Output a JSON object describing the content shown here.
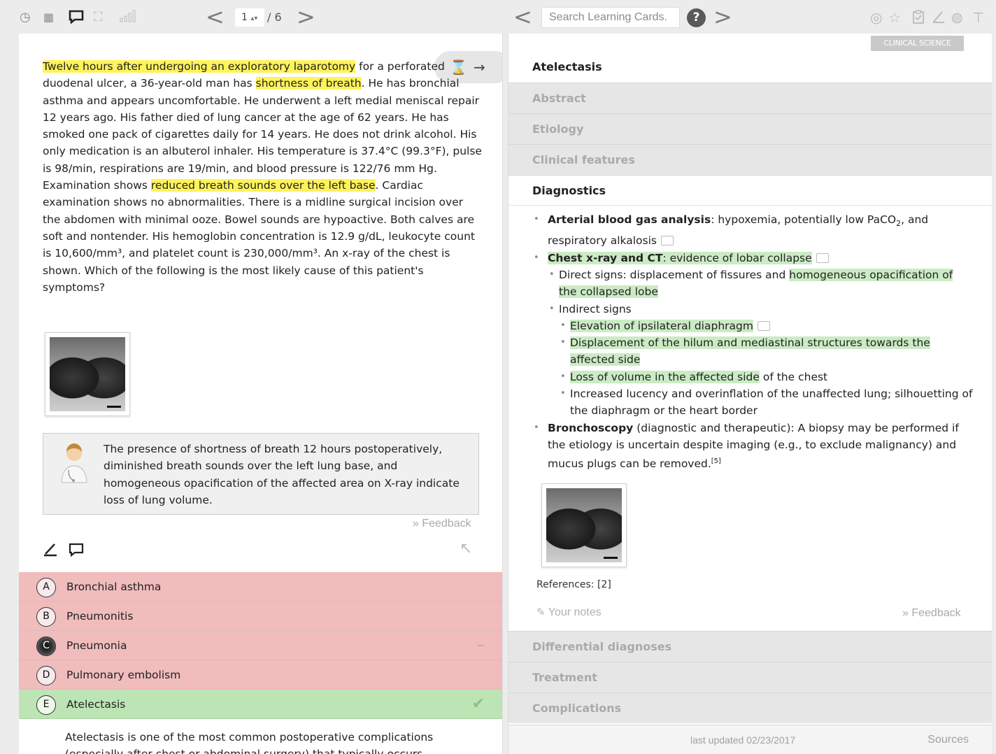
{
  "toolbar": {
    "page_current": "1",
    "page_total": "/ 6",
    "search_placeholder": "Search Learning Cards.",
    "help_label": "?"
  },
  "question": {
    "parts": [
      {
        "t": "Twelve hours after undergoing an exploratory laparotomy",
        "hl": true
      },
      {
        "t": " for a perforated duodenal ulcer, a 36-year-old man has ",
        "hl": false
      },
      {
        "t": "shortness of breath",
        "hl": true
      },
      {
        "t": ". He has bronchial asthma and appears uncomfortable. He underwent a left medial meniscal repair 12 years ago. His father died of lung cancer at the age of 62 years. He has smoked one pack of cigarettes daily for 14 years. He does not drink alcohol. His only medication is an albuterol inhaler. His temperature is 37.4°C (99.3°F), pulse is 98/min, respirations are 19/min, and blood pressure is 122/76 mm Hg. Examination shows ",
        "hl": false
      },
      {
        "t": "reduced breath sounds over the left base",
        "hl": true
      },
      {
        "t": ". Cardiac examination shows no abnormalities. There is a midline surgical incision over the abdomen with minimal ooze. Bowel sounds are hypoactive. Both calves are soft and nontender. His hemoglobin concentration is 12.9 g/dL, leukocyte count is 10,600/mm³, and platelet count is 230,000/mm³. An x-ray of the chest is shown. Which of the following is the most likely cause of this patient's symptoms?",
        "hl": false
      }
    ]
  },
  "explanation": "The presence of shortness of breath 12 hours postoperatively, diminished breath sounds over the left lung base, and homogeneous opacification of the affected area on X-ray indicate loss of lung volume.",
  "feedback_label": "» Feedback",
  "answers": [
    {
      "letter": "A",
      "label": "Bronchial asthma",
      "state": "wrong",
      "mark": ""
    },
    {
      "letter": "B",
      "label": "Pneumonitis",
      "state": "wrong",
      "mark": ""
    },
    {
      "letter": "C",
      "label": "Pneumonia",
      "state": "chosen",
      "mark": "–"
    },
    {
      "letter": "D",
      "label": "Pulmonary embolism",
      "state": "wrong",
      "mark": ""
    },
    {
      "letter": "E",
      "label": "Atelectasis",
      "state": "correct",
      "mark": "✔"
    }
  ],
  "answer_explanation": "Atelectasis is one of the most common postoperative complications (especially after chest or abdominal surgery) that typically occurs",
  "card": {
    "badge": "CLINICAL SCIENCE",
    "title": "Atelectasis",
    "sections": [
      "Abstract",
      "Etiology",
      "Clinical features",
      "Diagnostics",
      "Differential diagnoses",
      "Treatment",
      "Complications"
    ],
    "references_label": "References: [2]",
    "notes_placeholder": "Your notes",
    "feedback_label": "» Feedback",
    "last_updated": "last updated 02/23/2017",
    "sources_label": "Sources"
  },
  "colors": {
    "highlight_yellow": "#fff35a",
    "highlight_green": "#cbebc4",
    "wrong_answer_bg": "#f0bcbc",
    "correct_answer_bg": "#bde4b4"
  }
}
